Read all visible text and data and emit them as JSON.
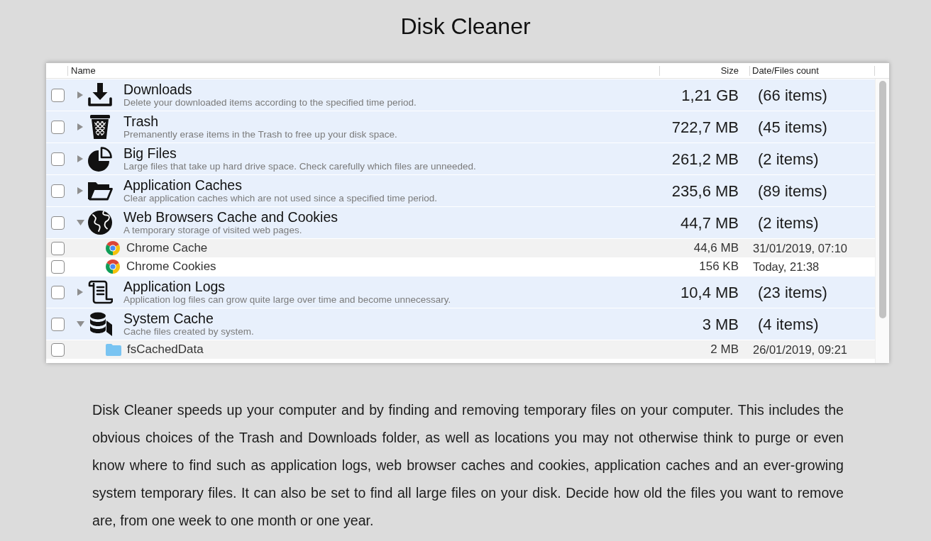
{
  "title": "Disk Cleaner",
  "table": {
    "columns": [
      "Name",
      "Size",
      "Date/Files count"
    ],
    "rows": [
      {
        "name": "Downloads",
        "description": "Delete your downloaded items according to the specified time period.",
        "size": "1,21 GB",
        "count": "(66 items)",
        "checked": false,
        "expanded": false
      },
      {
        "name": "Trash",
        "description": "Premanently erase items in the Trash to free up your disk space.",
        "size": "722,7 MB",
        "count": "(45 items)",
        "checked": false,
        "expanded": false
      },
      {
        "name": "Big Files",
        "description": "Large files that take up hard drive space. Check carefully which files are unneeded.",
        "size": "261,2 MB",
        "count": "(2 items)",
        "checked": false,
        "expanded": false
      },
      {
        "name": "Application Caches",
        "description": "Clear application caches which are not used since a specified time period.",
        "size": "235,6 MB",
        "count": "(89 items)",
        "checked": false,
        "expanded": false
      },
      {
        "name": "Web Browsers Cache and Cookies",
        "description": "A temporary storage of visited web pages.",
        "size": "44,7 MB",
        "count": "(2 items)",
        "checked": false,
        "expanded": true,
        "children": [
          {
            "name": "Chrome Cache",
            "size": "44,6 MB",
            "date": "31/01/2019, 07:10",
            "checked": false
          },
          {
            "name": "Chrome Cookies",
            "size": "156 KB",
            "date": "Today, 21:38",
            "checked": false
          }
        ]
      },
      {
        "name": "Application Logs",
        "description": "Application log files can grow quite large over time and become unnecessary.",
        "size": "10,4 MB",
        "count": "(23 items)",
        "checked": false,
        "expanded": false
      },
      {
        "name": "System Cache",
        "description": "Cache files created by system.",
        "size": "3 MB",
        "count": "(4 items)",
        "checked": false,
        "expanded": true,
        "children": [
          {
            "name": "fsCachedData",
            "size": "2 MB",
            "date": "26/01/2019, 09:21",
            "checked": false
          }
        ]
      }
    ]
  },
  "paragraph": "Disk Cleaner speeds up your computer and by finding and removing temporary files on your computer. This includes the obvious choices of the Trash and Downloads folder, as well as locations you may not otherwise think to purge or even know where to find such as application logs, web browser caches and cookies, application caches and an ever-growing system temporary files. It can also be set to find all large files on your disk. Decide how old the files you want to remove are, from one week to one month or one year."
}
